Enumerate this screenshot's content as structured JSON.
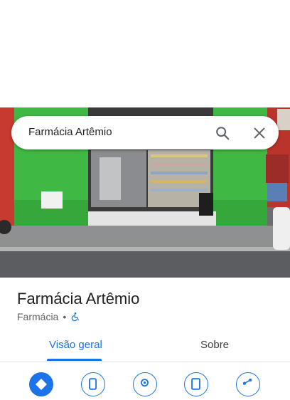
{
  "search": {
    "value": "Farmácia Artêmio"
  },
  "place": {
    "name": "Farmácia Artêmio",
    "category": "Farmácia",
    "separator": "•",
    "accessibility_icon": "wheelchair-icon"
  },
  "tabs": [
    {
      "label": "Visão geral",
      "active": true
    },
    {
      "label": "Sobre",
      "active": false
    }
  ],
  "actions": [
    {
      "icon": "directions-icon"
    },
    {
      "icon": "phone-icon"
    },
    {
      "icon": "location-icon"
    },
    {
      "icon": "save-icon"
    },
    {
      "icon": "share-icon"
    }
  ],
  "colors": {
    "accent": "#1a73e8",
    "storefront_green": "#3dba3f",
    "side_red": "#c8322c"
  }
}
